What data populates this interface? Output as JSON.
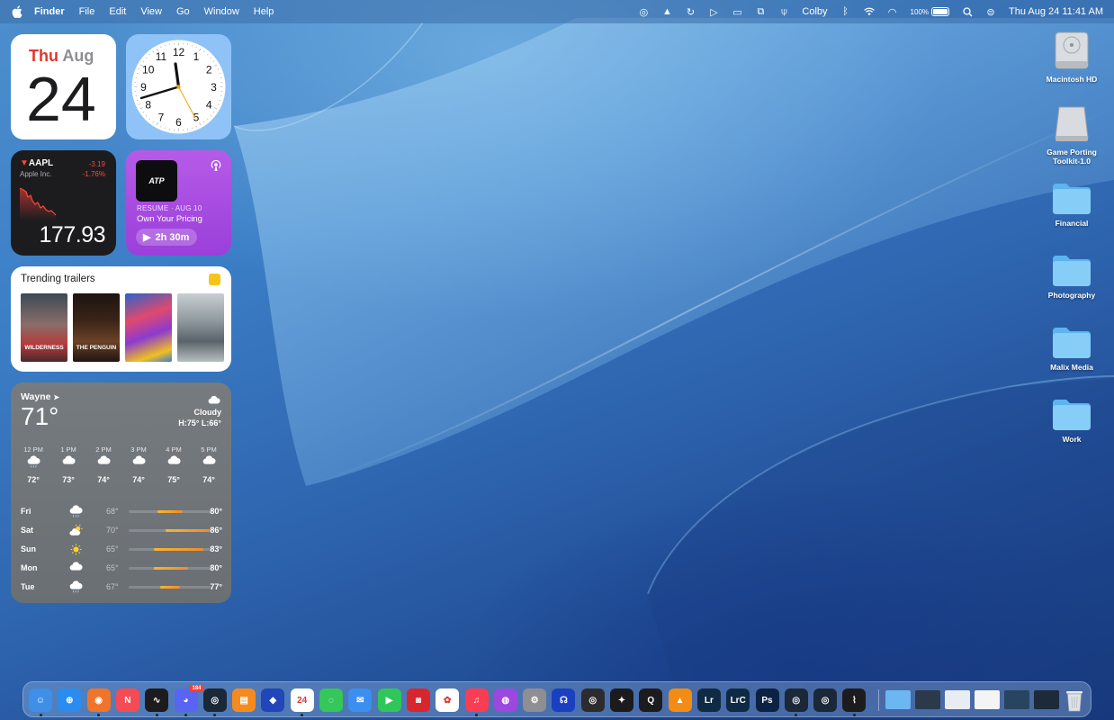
{
  "menubar": {
    "app_name": "Finder",
    "menus": [
      "File",
      "Edit",
      "View",
      "Go",
      "Window",
      "Help"
    ],
    "user": "Colby",
    "battery": "100%",
    "datetime": "Thu Aug 24  11:41 AM"
  },
  "calendar_widget": {
    "weekday": "Thu",
    "month": "Aug",
    "day": "24"
  },
  "clock_widget": {
    "numbers": [
      "12",
      "1",
      "2",
      "3",
      "4",
      "5",
      "6",
      "7",
      "8",
      "9",
      "10",
      "11"
    ],
    "time": "11:41"
  },
  "stock_widget": {
    "symbol": "AAPL",
    "company": "Apple Inc.",
    "change": "-3.19",
    "change_percent": "-1.76%",
    "price": "177.93"
  },
  "podcast_widget": {
    "artwork_text": "ATP",
    "status": "RESUME · AUG 10",
    "episode": "Own Your Pricing",
    "remaining": "2h 30m"
  },
  "trailers_widget": {
    "title": "Trending trailers",
    "posters": [
      {
        "text": "WILDERNESS"
      },
      {
        "text": "THE PENGUIN"
      },
      {
        "text": ""
      },
      {
        "text": ""
      }
    ]
  },
  "weather_widget": {
    "location": "Wayne",
    "temperature": "71°",
    "condition": "Cloudy",
    "hilo": "H:75° L:66°",
    "hourly": [
      {
        "time": "12 PM",
        "icon": "cloud-drizzle-icon",
        "temp": "72°"
      },
      {
        "time": "1 PM",
        "icon": "cloud-icon",
        "temp": "73°"
      },
      {
        "time": "2 PM",
        "icon": "cloud-icon",
        "temp": "74°"
      },
      {
        "time": "3 PM",
        "icon": "cloud-icon",
        "temp": "74°"
      },
      {
        "time": "4 PM",
        "icon": "cloud-icon",
        "temp": "75°"
      },
      {
        "time": "5 PM",
        "icon": "cloud-icon",
        "temp": "74°"
      }
    ],
    "daily": [
      {
        "day": "Fri",
        "icon": "cloud-drizzle-icon",
        "low": "68°",
        "high": "80°",
        "range_start": 0.35,
        "range_end": 0.65
      },
      {
        "day": "Sat",
        "icon": "partly-sunny-icon",
        "low": "70°",
        "high": "86°",
        "range_start": 0.45,
        "range_end": 0.98
      },
      {
        "day": "Sun",
        "icon": "sun-icon",
        "low": "65°",
        "high": "83°",
        "range_start": 0.3,
        "range_end": 0.9
      },
      {
        "day": "Mon",
        "icon": "cloud-icon",
        "low": "65°",
        "high": "80°",
        "range_start": 0.3,
        "range_end": 0.72
      },
      {
        "day": "Tue",
        "icon": "cloud-drizzle-icon",
        "low": "67°",
        "high": "77°",
        "range_start": 0.38,
        "range_end": 0.62
      }
    ]
  },
  "desktop_icons": [
    {
      "label": "Macintosh HD",
      "type": "drive"
    },
    {
      "label": "Game Porting Toolkit-1.0",
      "type": "drive"
    },
    {
      "label": "Financial",
      "type": "folder"
    },
    {
      "label": "Photography",
      "type": "folder"
    },
    {
      "label": "Malix Media",
      "type": "folder"
    },
    {
      "label": "Work",
      "type": "folder"
    }
  ],
  "dock": {
    "apps": [
      {
        "name": "finder-icon",
        "color": "#3d8fe8",
        "glyph": "☺",
        "running": true
      },
      {
        "name": "safari-icon",
        "color": "#2a8cf0",
        "glyph": "⊕",
        "running": false
      },
      {
        "name": "firefox-icon",
        "color": "#f0742a",
        "glyph": "◉",
        "running": true
      },
      {
        "name": "news-icon",
        "color": "#f44b55",
        "glyph": "N",
        "running": false
      },
      {
        "name": "stocks-icon",
        "color": "#1c1c1e",
        "glyph": "∿",
        "running": true
      },
      {
        "name": "discord-icon",
        "color": "#5865f2",
        "glyph": "◕",
        "running": true,
        "badge": "184"
      },
      {
        "name": "steam-icon",
        "color": "#1b2838",
        "glyph": "◎",
        "running": true
      },
      {
        "name": "books-icon",
        "color": "#f58a1f",
        "glyph": "▤",
        "running": false
      },
      {
        "name": "box-icon",
        "color": "#2046b8",
        "glyph": "◆",
        "running": false
      },
      {
        "name": "calendar-icon",
        "color": "#ffffff",
        "glyph": "24",
        "running": true
      },
      {
        "name": "messages-icon",
        "color": "#34c759",
        "glyph": "◌",
        "running": false
      },
      {
        "name": "mail-icon",
        "color": "#3a8ff0",
        "glyph": "✉",
        "running": false
      },
      {
        "name": "facetime-icon",
        "color": "#2fc75a",
        "glyph": "▶",
        "running": false
      },
      {
        "name": "photo-booth-icon",
        "color": "#d7262e",
        "glyph": "◙",
        "running": false
      },
      {
        "name": "photos-icon",
        "color": "#ffffff",
        "glyph": "✿",
        "running": false
      },
      {
        "name": "music-icon",
        "color": "#fa3d52",
        "glyph": "♫",
        "running": true
      },
      {
        "name": "podcasts-icon",
        "color": "#9b48df",
        "glyph": "◍",
        "running": false
      },
      {
        "name": "system-settings-icon",
        "color": "#8e8e93",
        "glyph": "⚙",
        "running": false
      },
      {
        "name": "headphones-icon",
        "color": "#1a3fc0",
        "glyph": "☊",
        "running": false
      },
      {
        "name": "disk-utility-icon",
        "color": "#2c2c2e",
        "glyph": "◎",
        "running": false
      },
      {
        "name": "final-cut-icon",
        "color": "#1b1b1d",
        "glyph": "✦",
        "running": false
      },
      {
        "name": "quicktime-icon",
        "color": "#1c1c1e",
        "glyph": "Q",
        "running": false
      },
      {
        "name": "vlc-icon",
        "color": "#f28c14",
        "glyph": "▲",
        "running": false
      },
      {
        "name": "lightroom-icon",
        "color": "#0f2a44",
        "glyph": "Lr",
        "running": false
      },
      {
        "name": "lightroom-classic-icon",
        "color": "#0f2a44",
        "glyph": "LrC",
        "running": false
      },
      {
        "name": "photoshop-icon",
        "color": "#0a2244",
        "glyph": "Ps",
        "running": false
      },
      {
        "name": "steam-icon",
        "color": "#1b2838",
        "glyph": "◎",
        "running": true
      },
      {
        "name": "steam-icon",
        "color": "#1b2838",
        "glyph": "◎",
        "running": false
      },
      {
        "name": "activity-monitor-icon",
        "color": "#1c1c1e",
        "glyph": "⌇",
        "running": true
      }
    ],
    "thumbnails": [
      {
        "name": "downloads-stack-icon",
        "color": "#6cb6f2"
      },
      {
        "name": "minimized-window-1",
        "color": "#2a3a4a"
      },
      {
        "name": "minimized-window-2",
        "color": "#e8edf3"
      },
      {
        "name": "minimized-window-3",
        "color": "#f4f4f4"
      },
      {
        "name": "minimized-window-4",
        "color": "#27455e"
      },
      {
        "name": "minimized-window-5",
        "color": "#1d2a3a"
      }
    ]
  }
}
